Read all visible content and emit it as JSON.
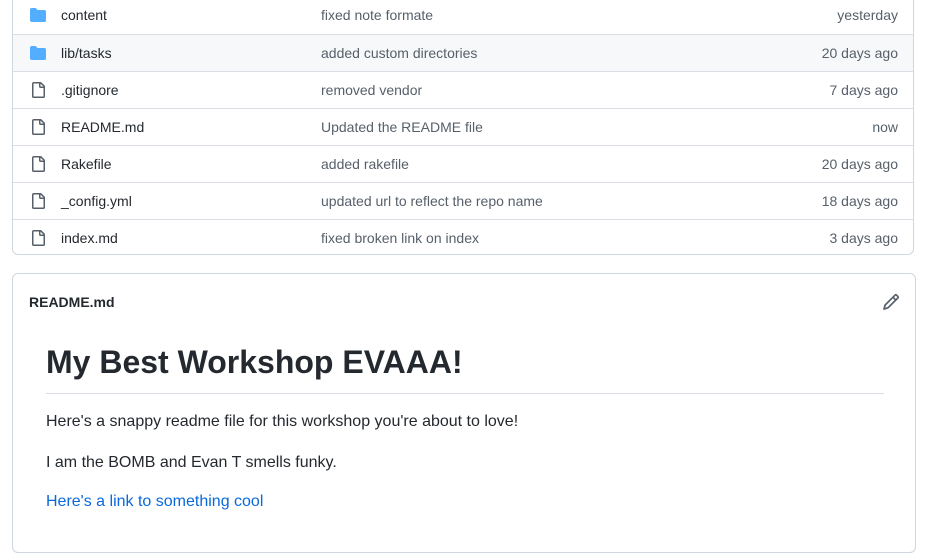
{
  "files": [
    {
      "name": "content",
      "type": "folder",
      "message": "fixed note formate",
      "age": "yesterday"
    },
    {
      "name": "lib/tasks",
      "type": "folder",
      "message": "added custom directories",
      "age": "20 days ago"
    },
    {
      "name": ".gitignore",
      "type": "file",
      "message": "removed vendor",
      "age": "7 days ago"
    },
    {
      "name": "README.md",
      "type": "file",
      "message": "Updated the README file",
      "age": "now"
    },
    {
      "name": "Rakefile",
      "type": "file",
      "message": "added rakefile",
      "age": "20 days ago"
    },
    {
      "name": "_config.yml",
      "type": "file",
      "message": "updated url to reflect the repo name",
      "age": "18 days ago"
    },
    {
      "name": "index.md",
      "type": "file",
      "message": "fixed broken link on index",
      "age": "3 days ago"
    }
  ],
  "readme": {
    "filename": "README.md",
    "title": "My Best Workshop EVAAA!",
    "paragraph_1": "Here's a snappy readme file for this workshop you're about to love!",
    "paragraph_2": "I am the BOMB and Evan T smells funky.",
    "link_text": "Here's a link to something cool"
  },
  "colors": {
    "folder_icon": "#54aeff",
    "file_icon": "#57606a",
    "link": "#0969da",
    "row_hover": "#f6f8fa"
  },
  "icons": {
    "folder": "folder-icon",
    "file": "file-icon",
    "edit": "pencil-icon"
  }
}
